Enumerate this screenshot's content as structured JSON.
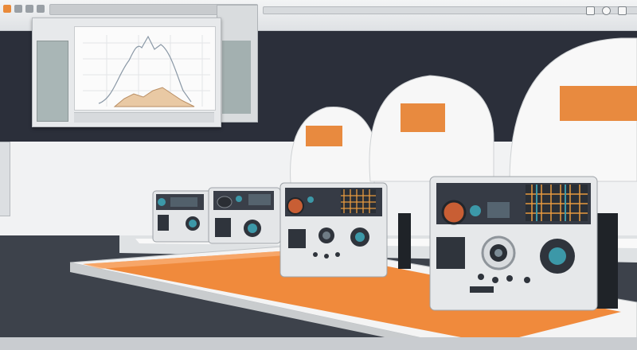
{
  "scene": {
    "description_tags": [
      "studio-backdrop",
      "analyzer-units",
      "monitor-window",
      "conveyor-belt"
    ],
    "colors": {
      "backdrop_dark": "#2b2f3a",
      "backdrop_light": "#f1f2f3",
      "accent_orange": "#e88a3f",
      "belt_orange": "#f08a3c",
      "unit_body": "#e4e6e8",
      "unit_panel": "#3a3f49",
      "lens_teal": "#3c98a8"
    },
    "icons": [
      "app-icon-orange",
      "window-controls",
      "lens-icon",
      "knob-icon",
      "grid-display-icon"
    ]
  }
}
